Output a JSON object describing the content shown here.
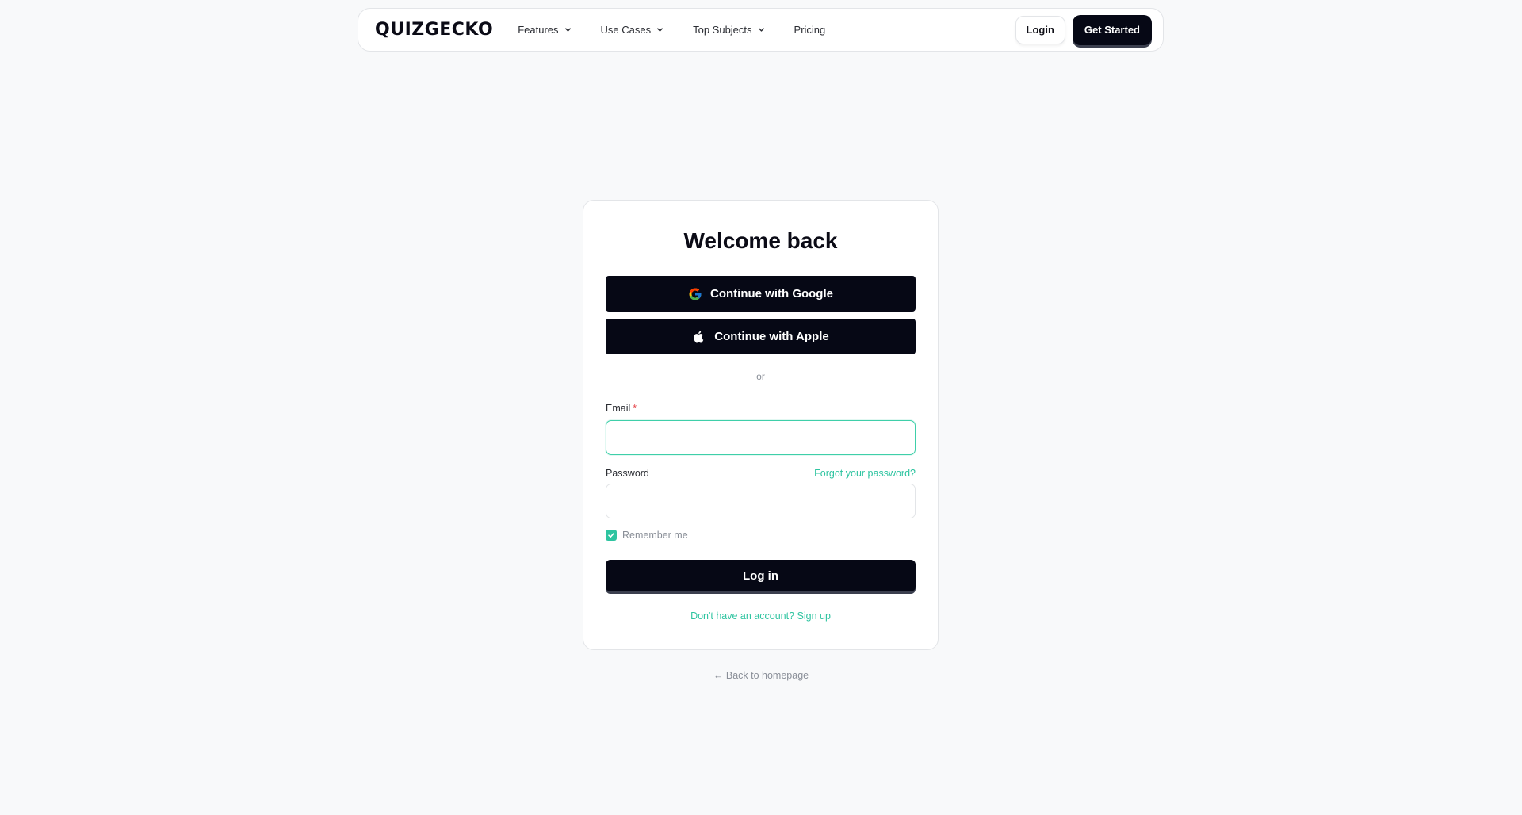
{
  "nav": {
    "logo": "QUIZGECKO",
    "links": [
      {
        "label": "Features",
        "has_dropdown": true
      },
      {
        "label": "Use Cases",
        "has_dropdown": true
      },
      {
        "label": "Top Subjects",
        "has_dropdown": true
      },
      {
        "label": "Pricing",
        "has_dropdown": false
      }
    ],
    "login_label": "Login",
    "get_started_label": "Get Started"
  },
  "login_card": {
    "title": "Welcome back",
    "google_label": "Continue with Google",
    "apple_label": "Continue with Apple",
    "divider_text": "or",
    "email_label": "Email",
    "email_required_mark": "*",
    "email_value": "",
    "password_label": "Password",
    "password_value": "",
    "forgot_password_label": "Forgot your password?",
    "remember_me_label": "Remember me",
    "remember_me_checked": true,
    "submit_label": "Log in",
    "signup_label": "Don't have an account? Sign up"
  },
  "back_link": "← Back to homepage",
  "colors": {
    "background": "#f8f9fa",
    "primary_dark": "#060815",
    "accent": "#2ec4a0",
    "required": "#e5484d"
  }
}
